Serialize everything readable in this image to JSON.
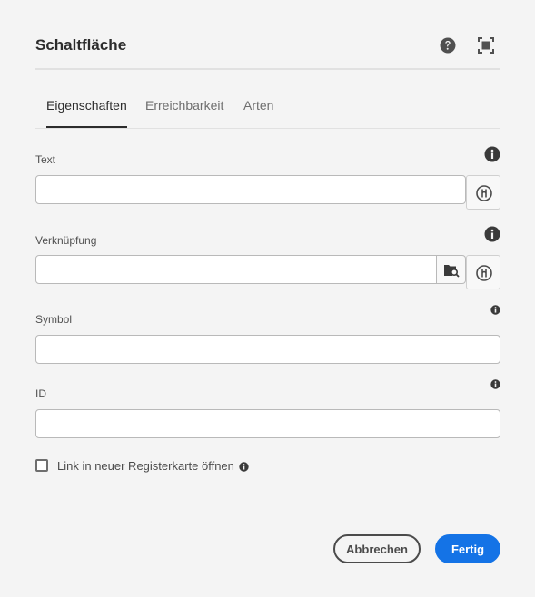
{
  "dialog": {
    "title": "Schaltfläche",
    "header_icons": [
      "help-icon",
      "fullscreen-icon"
    ]
  },
  "tabs": [
    {
      "label": "Eigenschaften",
      "active": true
    },
    {
      "label": "Erreichbarkeit",
      "active": false
    },
    {
      "label": "Arten",
      "active": false
    }
  ],
  "fields": {
    "text": {
      "label": "Text",
      "value": "",
      "placeholder": ""
    },
    "link": {
      "label": "Verknüpfung",
      "value": "",
      "placeholder": ""
    },
    "icon": {
      "label": "Symbol",
      "value": "",
      "placeholder": ""
    },
    "id": {
      "label": "ID",
      "value": "",
      "placeholder": ""
    }
  },
  "checkbox": {
    "label": "Link in neuer Registerkarte öffnen",
    "checked": false
  },
  "buttons": {
    "cancel": "Abbrechen",
    "done": "Fertig"
  },
  "colors": {
    "accent": "#1473e6",
    "background": "#f4f4f4",
    "text": "#4b4b4b"
  }
}
